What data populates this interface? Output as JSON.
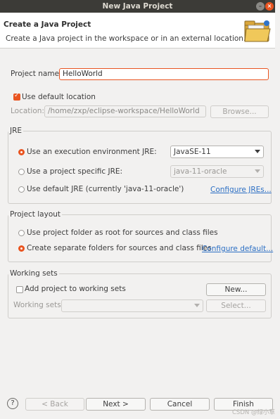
{
  "window": {
    "title": "New Java Project"
  },
  "header": {
    "title": "Create a Java Project",
    "subtitle": "Create a Java project in the workspace or in an external location."
  },
  "project": {
    "name_label": "Project name:",
    "name_value": "HelloWorld"
  },
  "location": {
    "use_default_label": "Use default location",
    "use_default_checked": true,
    "location_label": "Location:",
    "location_value": "/home/zxp/eclipse-workspace/HelloWorld",
    "browse_label": "Browse..."
  },
  "jre": {
    "group_title": "JRE",
    "exec_env_label": "Use an execution environment JRE:",
    "exec_env_value": "JavaSE-11",
    "specific_label": "Use a project specific JRE:",
    "specific_value": "java-11-oracle",
    "default_label": "Use default JRE (currently 'java-11-oracle')",
    "configure_link": "Configure JREs..."
  },
  "layout": {
    "group_title": "Project layout",
    "root_label": "Use project folder as root for sources and class files",
    "separate_label": "Create separate folders for sources and class files",
    "configure_link": "Configure default..."
  },
  "working_sets": {
    "group_title": "Working sets",
    "add_label": "Add project to working sets",
    "new_label": "New...",
    "sets_label": "Working sets:",
    "select_label": "Select..."
  },
  "footer": {
    "back_label": "< Back",
    "next_label": "Next >",
    "cancel_label": "Cancel",
    "finish_label": "Finish"
  },
  "watermark": "CSDN @绿小草",
  "colors": {
    "accent": "#e95420",
    "titlebar": "#3c3b37",
    "link": "#2c6fc4"
  }
}
